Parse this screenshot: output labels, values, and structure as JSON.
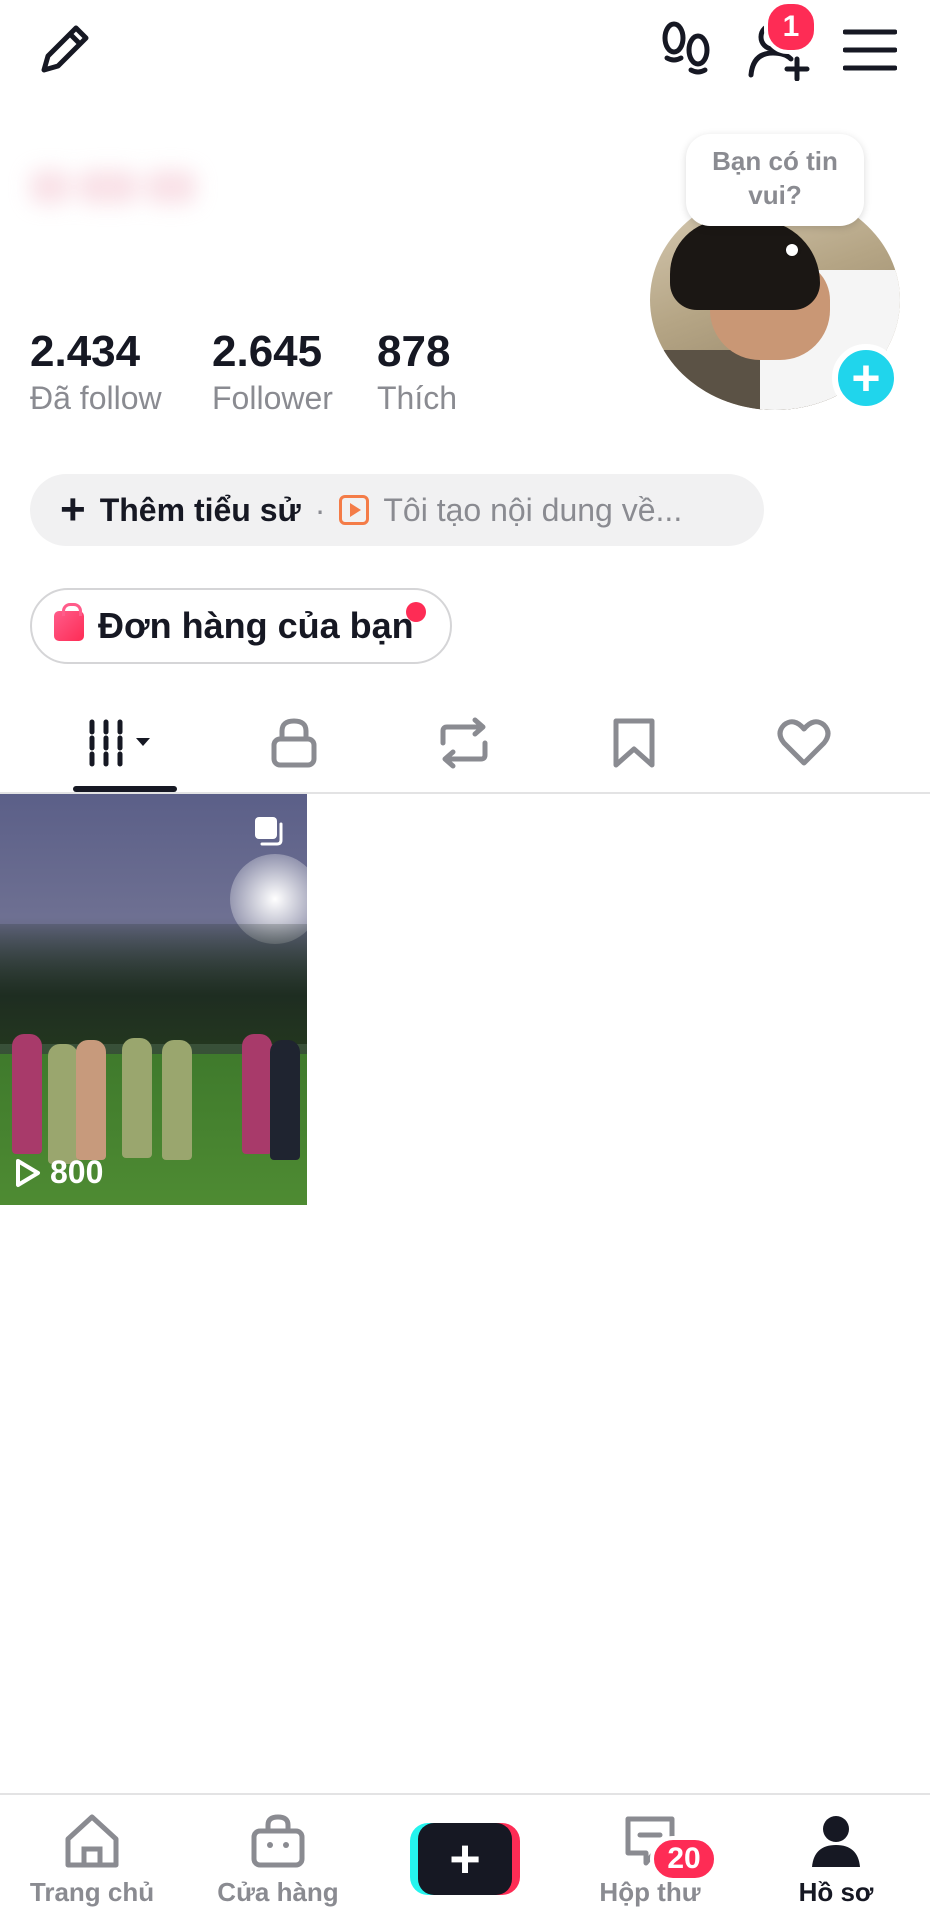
{
  "top_bar": {
    "edit_icon": "pencil-icon",
    "footprints_icon": "footprints-icon",
    "add_friend_icon": "add-user-icon",
    "add_friend_badge": "1",
    "menu_icon": "hamburger-menu-icon"
  },
  "profile": {
    "stats": [
      {
        "value": "2.434",
        "label": "Đã follow"
      },
      {
        "value": "2.645",
        "label": "Follower"
      },
      {
        "value": "878",
        "label": "Thích"
      }
    ],
    "avatar_bubble": "Bạn có tin vui?",
    "avatar_add_symbol": "+"
  },
  "bio": {
    "plus_symbol": "+",
    "add_label": "Thêm tiểu sử",
    "separator": "·",
    "hint": "Tôi tạo nội dung về..."
  },
  "orders": {
    "label": "Đơn hàng của bạn"
  },
  "tabs": [
    {
      "name": "videos",
      "icon": "grid-icon",
      "active": true
    },
    {
      "name": "private",
      "icon": "lock-icon"
    },
    {
      "name": "reposts",
      "icon": "repost-icon"
    },
    {
      "name": "favorites",
      "icon": "bookmark-icon"
    },
    {
      "name": "liked",
      "icon": "heart-icon"
    }
  ],
  "videos": [
    {
      "views": "800"
    }
  ],
  "bottom_nav": {
    "items": [
      {
        "label": "Trang chủ",
        "icon": "home-icon"
      },
      {
        "label": "Cửa hàng",
        "icon": "shop-icon"
      },
      {
        "label": "",
        "icon": "create-icon"
      },
      {
        "label": "Hộp thư",
        "icon": "inbox-icon",
        "badge": "20"
      },
      {
        "label": "Hồ sơ",
        "icon": "profile-icon",
        "active": true
      }
    ],
    "create_symbol": "+"
  },
  "colors": {
    "accent_red": "#fe2c55",
    "accent_cyan": "#20d5ec",
    "text_primary": "#161823",
    "text_secondary": "#8a8b91"
  }
}
